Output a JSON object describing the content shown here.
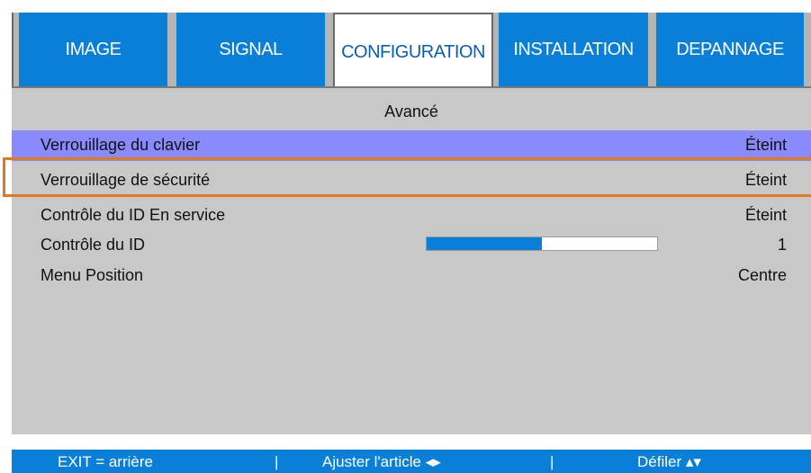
{
  "tabs": [
    {
      "label": "IMAGE",
      "active": false
    },
    {
      "label": "SIGNAL",
      "active": false
    },
    {
      "label": "CONFIGURATION",
      "active": true
    },
    {
      "label": "INSTALLATION",
      "active": false
    },
    {
      "label": "DEPANNAGE",
      "active": false
    }
  ],
  "panel": {
    "title": "Avancé",
    "rows": [
      {
        "label": "Verrouillage du clavier",
        "value": "Éteint",
        "selected": true
      },
      {
        "label": "Verrouillage de sécurité",
        "value": "Éteint",
        "selected": false,
        "highlighted": true
      },
      {
        "label": "Contrôle du ID En service",
        "value": "Éteint",
        "selected": false
      },
      {
        "label": "Contrôle du ID",
        "value": "1",
        "slider_fraction": 0.5
      },
      {
        "label": "Menu Position",
        "value": "Centre",
        "selected": false
      }
    ]
  },
  "footer": {
    "exit": "EXIT = arrière",
    "sep1": "|",
    "adjust": "Ajuster l'article ◂▸",
    "sep2": "|",
    "scroll": "Défiler ▴▾"
  },
  "colors": {
    "tab_blue": "#0a7fd8",
    "panel_gray": "#c8c8c8",
    "selection": "#8a8aff",
    "highlight_border": "#e07a1e"
  }
}
